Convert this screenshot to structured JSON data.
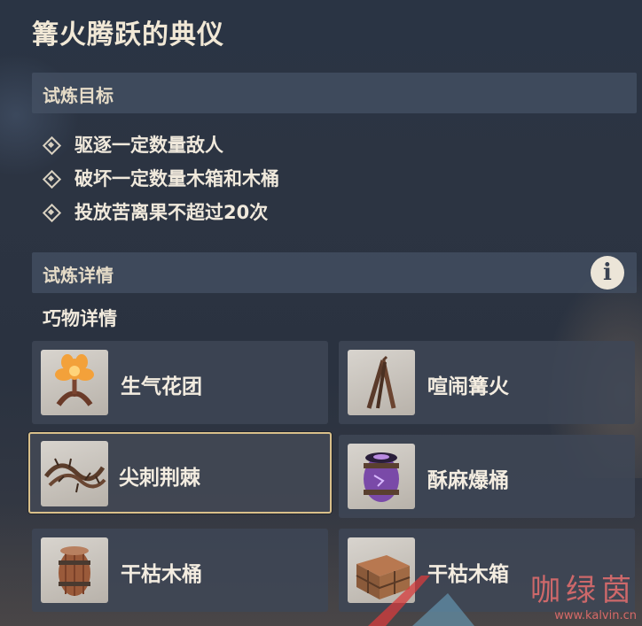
{
  "title": "篝火腾跃的典仪",
  "objectives_section": {
    "label": "试炼目标",
    "items": [
      "驱逐一定数量敌人",
      "破坏一定数量木箱和木桶",
      "投放苦离果不超过20次"
    ]
  },
  "details_section": {
    "label": "试炼详情",
    "info_icon": "info-icon"
  },
  "gadgets": {
    "heading": "巧物详情",
    "items": [
      {
        "name": "生气花团",
        "icon": "flower-bouquet-icon"
      },
      {
        "name": "喧闹篝火",
        "icon": "bonfire-icon"
      },
      {
        "name": "尖刺荆棘",
        "icon": "thorn-vine-icon",
        "selected": true
      },
      {
        "name": "酥麻爆桶",
        "icon": "electro-barrel-icon"
      },
      {
        "name": "干枯木桶",
        "icon": "wooden-barrel-icon"
      },
      {
        "name": "干枯木箱",
        "icon": "wooden-crate-icon"
      }
    ]
  },
  "watermark": {
    "big": "咖绿茵",
    "small": "www.kalvin.cn"
  },
  "colors": {
    "accent_border": "#d9c08a",
    "text": "#ece5d8"
  }
}
